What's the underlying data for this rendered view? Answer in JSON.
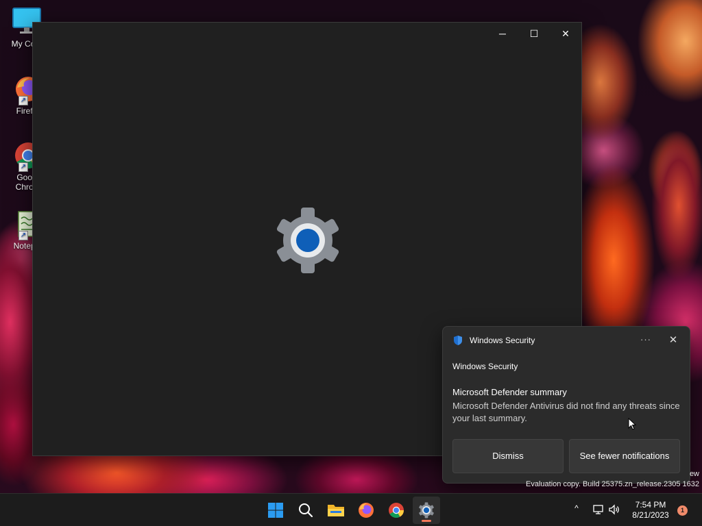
{
  "desktop": {
    "icons": [
      {
        "label": "My Com",
        "icon": "computer-icon"
      },
      {
        "label": "Firefo",
        "icon": "firefox-icon"
      },
      {
        "label": "Goog\nChron",
        "label_line1": "Goog",
        "label_line2": "Chron",
        "icon": "chrome-icon"
      },
      {
        "label": "Notepa",
        "icon": "notepad-icon"
      }
    ]
  },
  "window": {
    "app": "Settings",
    "icon": "settings-gear-icon",
    "controls": {
      "minimize": "─",
      "maximize": "☐",
      "close": "✕"
    }
  },
  "toast": {
    "app_name": "Windows Security",
    "more": "···",
    "close": "✕",
    "subheader": "Windows Security",
    "title": "Microsoft Defender summary",
    "body": "Microsoft Defender Antivirus did not find any threats since your last summary.",
    "buttons": {
      "dismiss": "Dismiss",
      "see_fewer": "See fewer notifications"
    }
  },
  "watermark": {
    "line1": "ew",
    "line2": "Evaluation copy. Build 25375.zn_release.2305 1632"
  },
  "taskbar": {
    "apps": [
      {
        "name": "Start",
        "icon": "windows-start-icon"
      },
      {
        "name": "Search",
        "icon": "search-icon"
      },
      {
        "name": "File Explorer",
        "icon": "folder-icon"
      },
      {
        "name": "Firefox",
        "icon": "firefox-icon"
      },
      {
        "name": "Google Chrome",
        "icon": "chrome-icon"
      },
      {
        "name": "Settings",
        "icon": "settings-gear-icon",
        "active": true
      }
    ],
    "tray": {
      "chevron": "^",
      "time": "7:54 PM",
      "date": "8/21/2023",
      "notification_count": "1"
    }
  },
  "colors": {
    "accent": "#0067c0",
    "badge": "#f08a6a",
    "window_bg": "#202020",
    "toast_bg": "#2b2b2b"
  }
}
